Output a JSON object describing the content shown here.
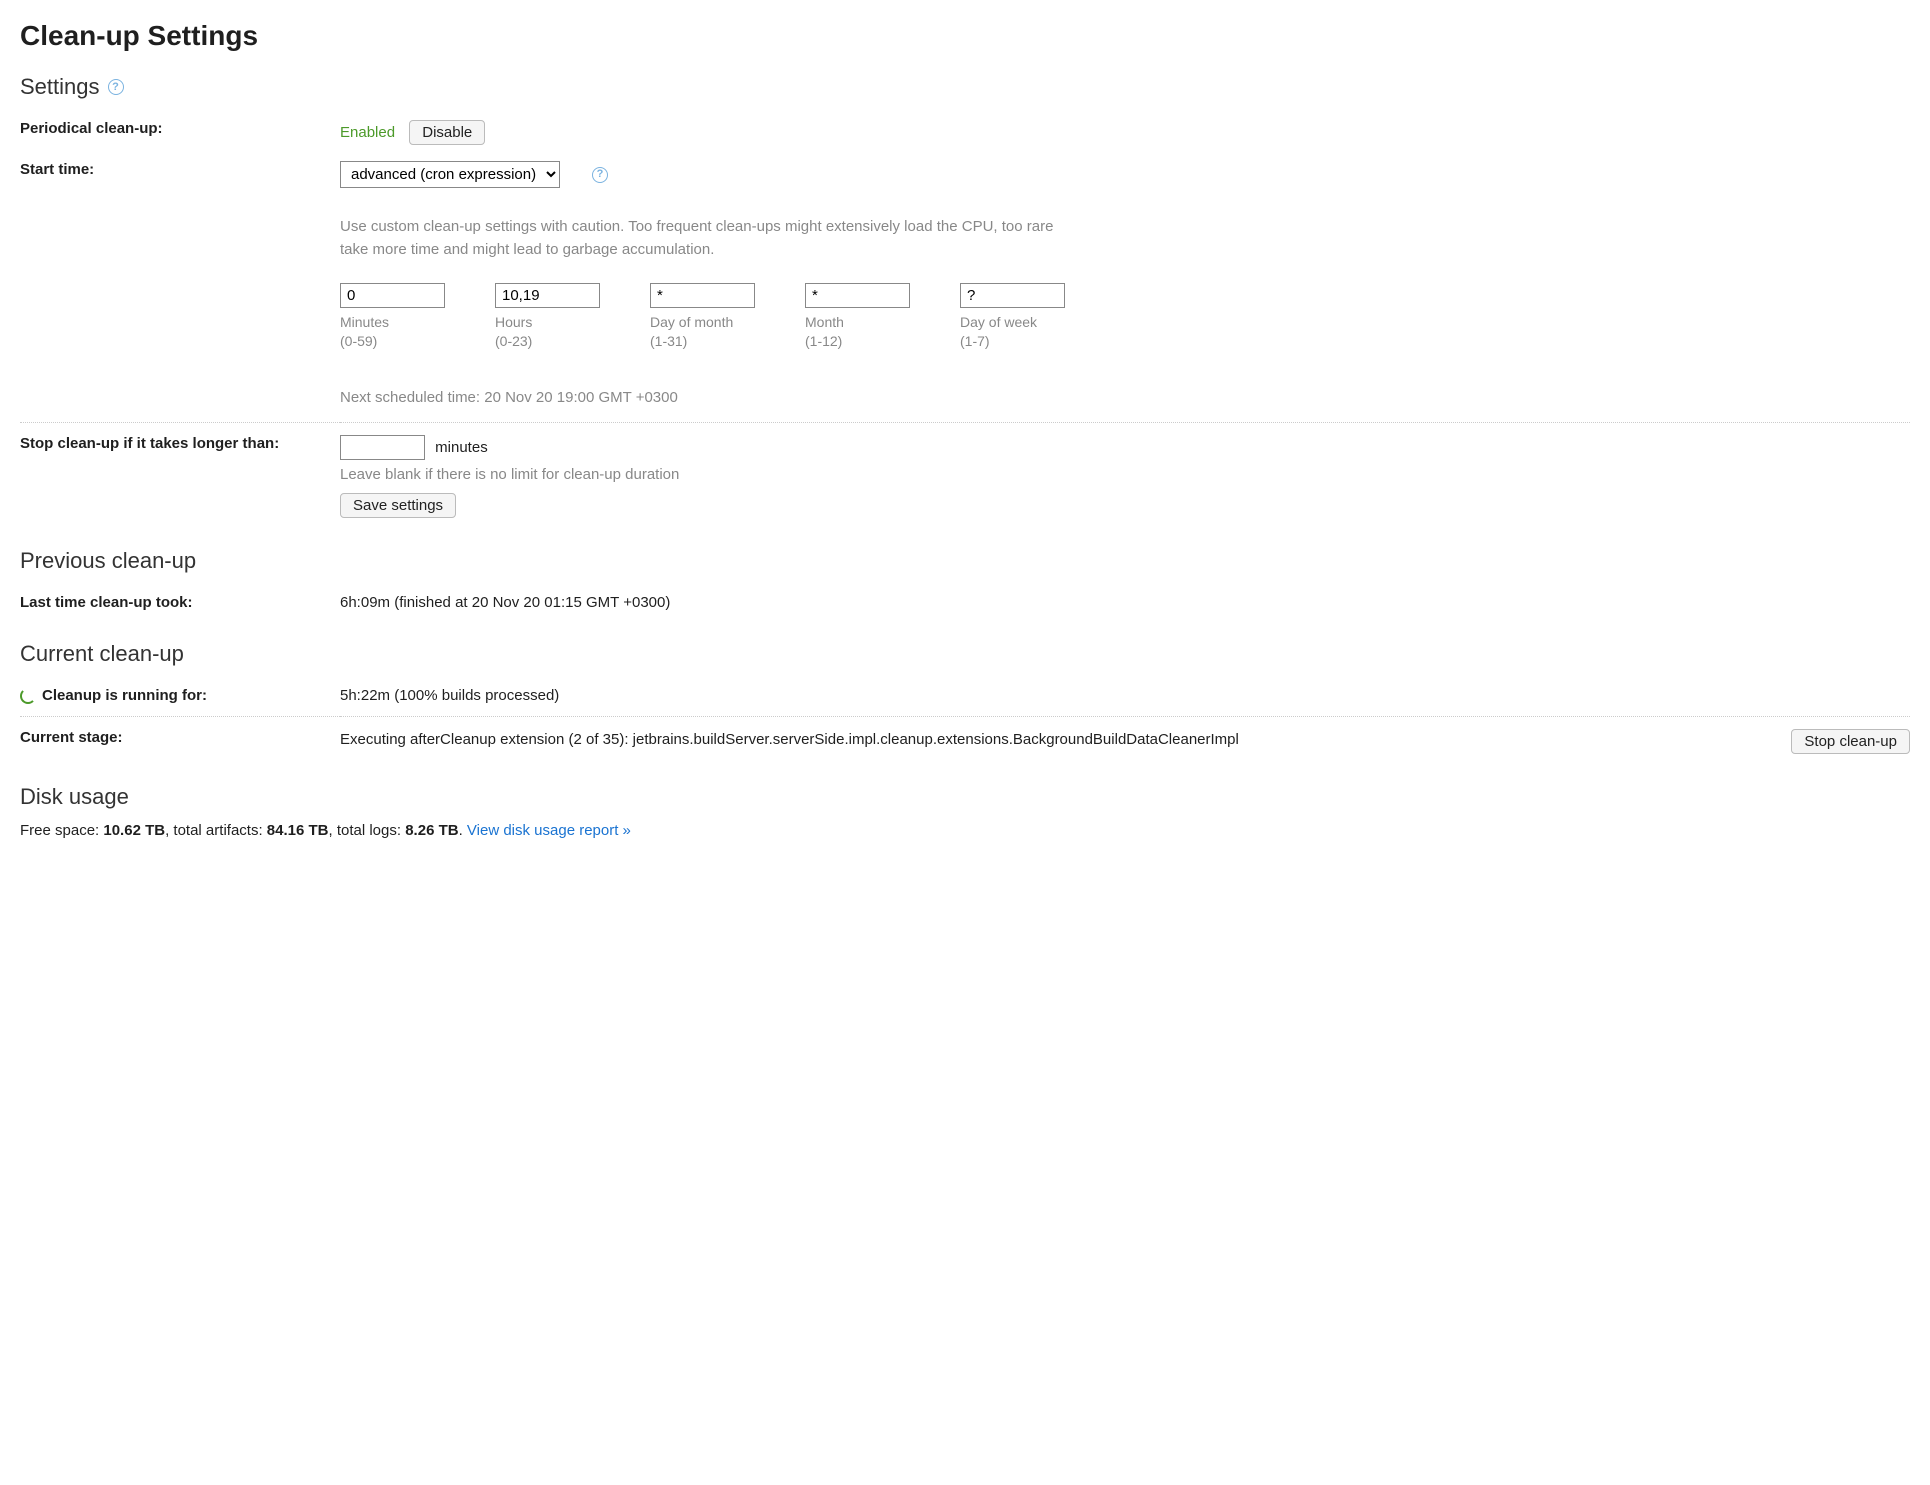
{
  "page": {
    "title": "Clean-up Settings"
  },
  "settings": {
    "heading": "Settings",
    "periodical": {
      "label": "Periodical clean-up:",
      "status": "Enabled",
      "disable_button": "Disable"
    },
    "start_time": {
      "label": "Start time:",
      "select_value": "advanced (cron expression)",
      "caution": "Use custom clean-up settings with caution. Too frequent clean-ups might extensively load the CPU, too rare take more time and might lead to garbage accumulation.",
      "cron": {
        "minutes": {
          "value": "0",
          "label": "Minutes",
          "range": "(0-59)"
        },
        "hours": {
          "value": "10,19",
          "label": "Hours",
          "range": "(0-23)"
        },
        "day_of_month": {
          "value": "*",
          "label": "Day of month",
          "range": "(1-31)"
        },
        "month": {
          "value": "*",
          "label": "Month",
          "range": "(1-12)"
        },
        "day_of_week": {
          "value": "?",
          "label": "Day of week",
          "range": "(1-7)"
        }
      },
      "next_scheduled": "Next scheduled time: 20 Nov 20 19:00 GMT +0300"
    },
    "stop_if": {
      "label": "Stop clean-up if it takes longer than:",
      "value": "",
      "unit": "minutes",
      "hint": "Leave blank if there is no limit for clean-up duration",
      "save_button": "Save settings"
    }
  },
  "previous": {
    "heading": "Previous clean-up",
    "last_time_label": "Last time clean-up took:",
    "last_time_value": "6h:09m (finished at 20 Nov 20 01:15 GMT +0300)"
  },
  "current": {
    "heading": "Current clean-up",
    "running_label": "Cleanup is running for:",
    "running_value": "5h:22m (100% builds processed)",
    "stage_label": "Current stage:",
    "stage_value": "Executing afterCleanup extension (2 of 35): jetbrains.buildServer.serverSide.impl.cleanup.extensions.BackgroundBuildDataCleanerImpl",
    "stop_button": "Stop clean-up"
  },
  "disk": {
    "heading": "Disk usage",
    "free_label": "Free space: ",
    "free_value": "10.62 TB",
    "artifacts_label": ", total artifacts: ",
    "artifacts_value": "84.16 TB",
    "logs_label": ", total logs: ",
    "logs_value": "8.26 TB",
    "period": ". ",
    "report_link": "View disk usage report »"
  }
}
